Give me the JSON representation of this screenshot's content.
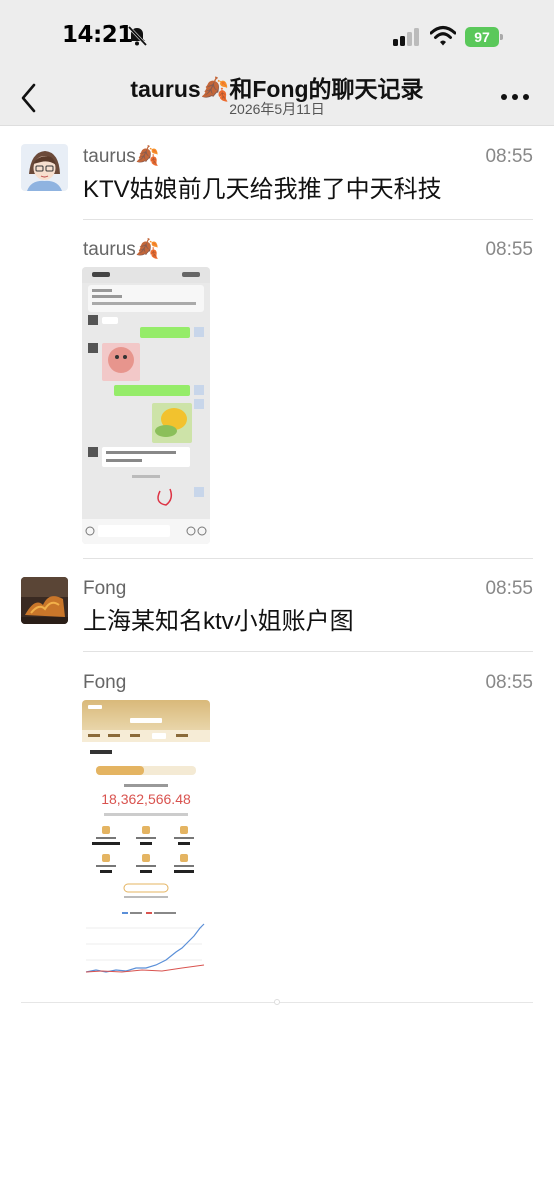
{
  "status_bar": {
    "time": "14:21",
    "battery": "97"
  },
  "header": {
    "title": "taurus🍂和Fong的聊天记录",
    "date": "2026年5月11日"
  },
  "messages": [
    {
      "sender": "taurus🍂",
      "time": "08:55",
      "text": "KTV姑娘前几天给我推了中天科技"
    },
    {
      "sender": "taurus🍂",
      "time": "08:55"
    },
    {
      "sender": "Fong",
      "time": "08:55",
      "text": "上海某知名ktv小姐账户图"
    },
    {
      "sender": "Fong",
      "time": "08:55"
    }
  ],
  "colors": {
    "nav_bg": "#ededed",
    "battery": "#5ac85a",
    "chart_green": "#5ac85a",
    "amount_red": "#d9534f"
  }
}
